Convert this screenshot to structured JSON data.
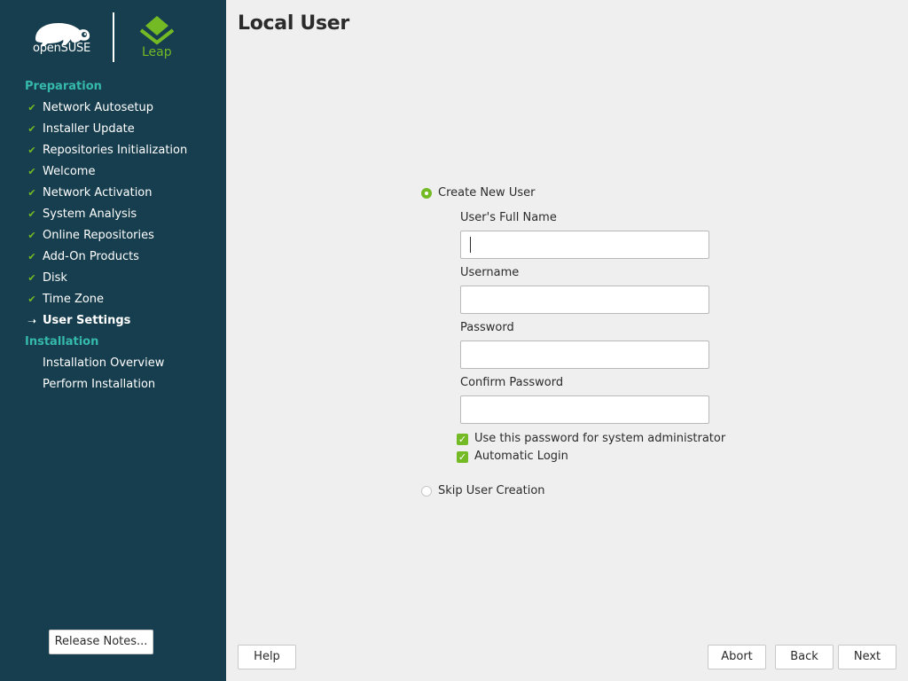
{
  "branding": {
    "opensuse_text": "openSUSE",
    "leap_text": "Leap",
    "colors": {
      "sidebar": "#173e4e",
      "accent_green": "#73ba25",
      "section_teal": "#35b9ab"
    }
  },
  "sidebar": {
    "sections": [
      {
        "title": "Preparation",
        "steps": [
          {
            "label": "Network Autosetup",
            "status": "done",
            "icon": "check-icon"
          },
          {
            "label": "Installer Update",
            "status": "done",
            "icon": "check-icon"
          },
          {
            "label": "Repositories Initialization",
            "status": "done",
            "icon": "check-icon"
          },
          {
            "label": "Welcome",
            "status": "done",
            "icon": "check-icon"
          },
          {
            "label": "Network Activation",
            "status": "done",
            "icon": "check-icon"
          },
          {
            "label": "System Analysis",
            "status": "done",
            "icon": "check-icon"
          },
          {
            "label": "Online Repositories",
            "status": "done",
            "icon": "check-icon"
          },
          {
            "label": "Add-On Products",
            "status": "done",
            "icon": "check-icon"
          },
          {
            "label": "Disk",
            "status": "done",
            "icon": "check-icon"
          },
          {
            "label": "Time Zone",
            "status": "done",
            "icon": "check-icon"
          },
          {
            "label": "User Settings",
            "status": "current",
            "icon": "arrow-right-icon"
          }
        ]
      },
      {
        "title": "Installation",
        "steps": [
          {
            "label": "Installation Overview",
            "status": "pending"
          },
          {
            "label": "Perform Installation",
            "status": "pending"
          }
        ]
      }
    ],
    "release_notes_label": "Release Notes..."
  },
  "main": {
    "title": "Local User",
    "create_user_option": {
      "label": "Create New User",
      "selected": true
    },
    "fields": {
      "full_name": {
        "label": "User's Full Name",
        "value": ""
      },
      "username": {
        "label": "Username",
        "value": ""
      },
      "password": {
        "label": "Password",
        "value": ""
      },
      "confirm_password": {
        "label": "Confirm Password",
        "value": ""
      }
    },
    "checkboxes": {
      "admin_password": {
        "label": "Use this password for system administrator",
        "checked": true
      },
      "auto_login": {
        "label": "Automatic Login",
        "checked": true
      }
    },
    "skip_user_option": {
      "label": "Skip User Creation",
      "selected": false
    }
  },
  "footer": {
    "help": "Help",
    "abort": "Abort",
    "back": "Back",
    "next": "Next"
  }
}
